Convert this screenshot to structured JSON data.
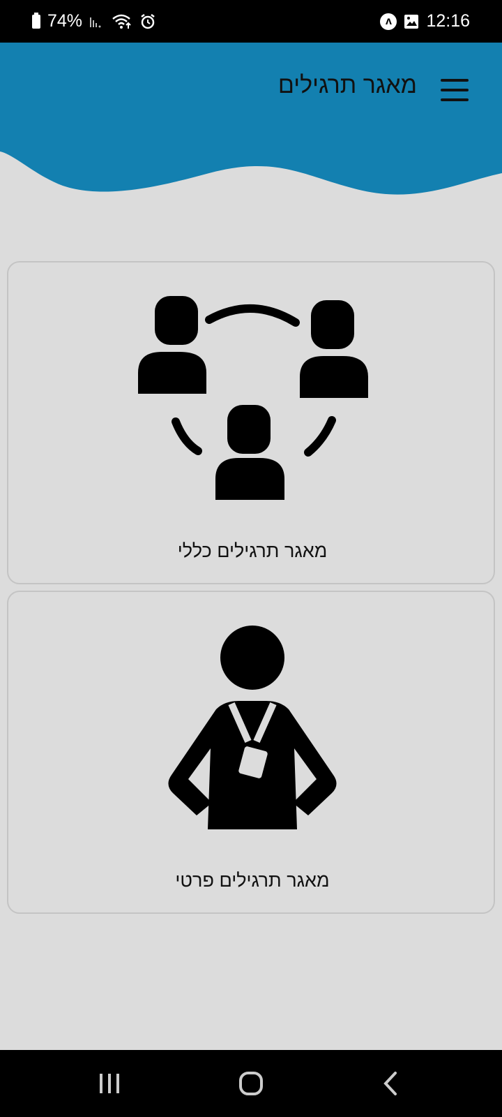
{
  "status_bar": {
    "battery": "74%",
    "time": "12:16",
    "notification_badge": "ʌ"
  },
  "header": {
    "title": "מאגר תרגילים",
    "bg_color": "#1380b0"
  },
  "cards": {
    "general": {
      "label": "מאגר תרגילים כללי",
      "icon": "group-network-icon"
    },
    "private": {
      "label": "מאגר תרגילים פרטי",
      "icon": "person-with-badge-icon"
    }
  },
  "nav": {
    "recent_icon": "recent-apps-icon",
    "home_icon": "home-icon",
    "back_icon": "back-icon"
  }
}
